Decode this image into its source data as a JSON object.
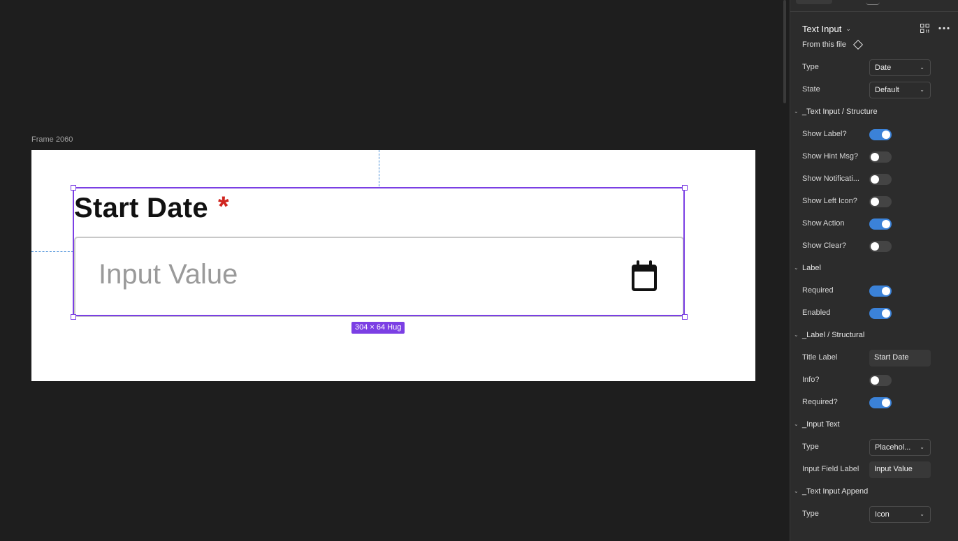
{
  "canvas": {
    "frame_name": "Frame 2060",
    "component": {
      "title_label": "Start Date",
      "required_mark": "*",
      "input_placeholder": "Input Value",
      "append_icon": "calendar-icon"
    },
    "size_badge": "304 × 64 Hug"
  },
  "panel": {
    "component_name": "Text Input",
    "source": "From this file",
    "properties": [
      {
        "kind": "dropdown",
        "label": "Type",
        "value": "Date"
      },
      {
        "kind": "dropdown",
        "label": "State",
        "value": "Default"
      },
      {
        "kind": "section",
        "label": "_Text Input / Structure"
      },
      {
        "kind": "toggle",
        "label": "Show Label?",
        "on": true
      },
      {
        "kind": "toggle",
        "label": "Show Hint Msg?",
        "on": false
      },
      {
        "kind": "toggle",
        "label": "Show Notificati...",
        "on": false
      },
      {
        "kind": "toggle",
        "label": "Show Left Icon?",
        "on": false
      },
      {
        "kind": "toggle",
        "label": "Show Action",
        "on": true
      },
      {
        "kind": "toggle",
        "label": "Show Clear?",
        "on": false
      },
      {
        "kind": "section",
        "label": "Label"
      },
      {
        "kind": "toggle",
        "label": "Required",
        "on": true
      },
      {
        "kind": "toggle",
        "label": "Enabled",
        "on": true
      },
      {
        "kind": "section",
        "label": "_Label / Structural"
      },
      {
        "kind": "text",
        "label": "Title Label",
        "value": "Start Date"
      },
      {
        "kind": "toggle",
        "label": "Info?",
        "on": false
      },
      {
        "kind": "toggle",
        "label": "Required?",
        "on": true
      },
      {
        "kind": "section",
        "label": "_Input Text"
      },
      {
        "kind": "dropdown",
        "label": "Type",
        "value": "Placehol..."
      },
      {
        "kind": "text",
        "label": "Input Field Label",
        "value": "Input Value"
      },
      {
        "kind": "section",
        "label": "_Text Input Append"
      },
      {
        "kind": "dropdown",
        "label": "Type",
        "value": "Icon"
      }
    ]
  },
  "colors": {
    "selection": "#7b3fe4",
    "toggle_on": "#3b82d8",
    "required_star": "#d0251f",
    "canvas_bg": "#1e1e1e",
    "panel_bg": "#2c2c2c"
  }
}
